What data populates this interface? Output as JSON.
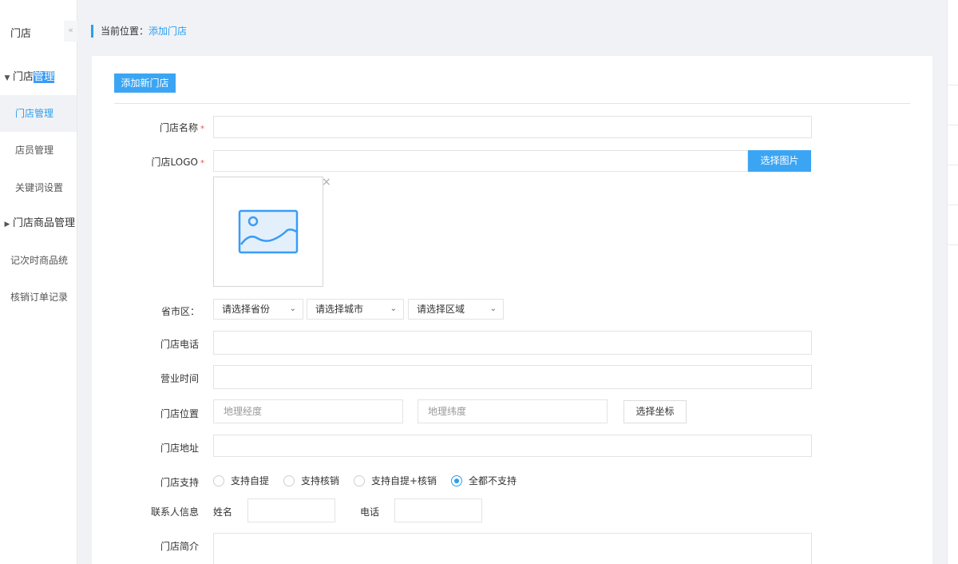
{
  "sidebar": {
    "title": "门店",
    "collapse_icon": "«",
    "items": [
      {
        "label_a": "门店",
        "label_b": "管理"
      },
      {
        "label": "门店管理"
      },
      {
        "label": "店员管理"
      },
      {
        "label": "关键词设置"
      },
      {
        "label": "门店商品管理"
      },
      {
        "label": "记次时商品统"
      },
      {
        "label": "核销订单记录"
      }
    ]
  },
  "breadcrumb": {
    "prefix": "当前位置：",
    "current": "添加门店"
  },
  "toolbar": {
    "add_label": "添加新门店"
  },
  "form": {
    "name_label": "门店名称",
    "logo_label": "门店LOGO",
    "required_mark": "*",
    "pick_image_label": "选择图片",
    "remove_icon": "×",
    "region_label": "省市区：",
    "province": "请选择省份",
    "city": "请选择城市",
    "district": "请选择区域",
    "phone_label": "门店电话",
    "hours_label": "营业时间",
    "location_label": "门店位置",
    "longitude_placeholder": "地理经度",
    "latitude_placeholder": "地理纬度",
    "pick_coord_label": "选择坐标",
    "address_label": "门店地址",
    "support_label": "门店支持",
    "support_options": [
      "支持自提",
      "支持核销",
      "支持自提+核销",
      "全都不支持"
    ],
    "support_selected": 3,
    "contact_label": "联系人信息",
    "contact_name_label": "姓名",
    "contact_phone_label": "电话",
    "intro_label": "门店简介"
  },
  "colors": {
    "accent": "#2a9ef0",
    "button": "#3ba5f4",
    "required": "#e5534b"
  },
  "icons": {
    "image_placeholder": "image-icon",
    "chevron": "chevron-down-icon"
  }
}
